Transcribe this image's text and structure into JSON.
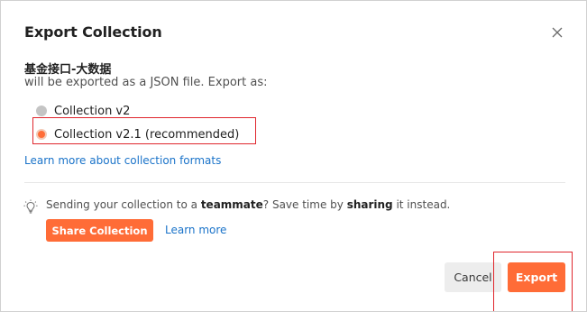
{
  "dialog": {
    "title": "Export Collection",
    "close_icon": "close-icon"
  },
  "collection": {
    "name": "基金接口-大数据",
    "description": "will be exported as a JSON file. Export as:"
  },
  "format_options": [
    {
      "label": "Collection v2",
      "selected": false
    },
    {
      "label": "Collection v2.1 (recommended)",
      "selected": true
    }
  ],
  "learn_formats_link": "Learn more about collection formats",
  "share": {
    "icon": "lightbulb-icon",
    "text_before": "Sending your collection to a ",
    "text_bold_1": "teammate",
    "text_middle": "? Save time by ",
    "text_bold_2": "sharing",
    "text_after": " it instead.",
    "button_label": "Share Collection",
    "learn_more_label": "Learn more"
  },
  "footer": {
    "cancel_label": "Cancel",
    "export_label": "Export"
  },
  "colors": {
    "accent": "#ff6c37",
    "link": "#1a73c9",
    "annotation": "#e0262d"
  }
}
